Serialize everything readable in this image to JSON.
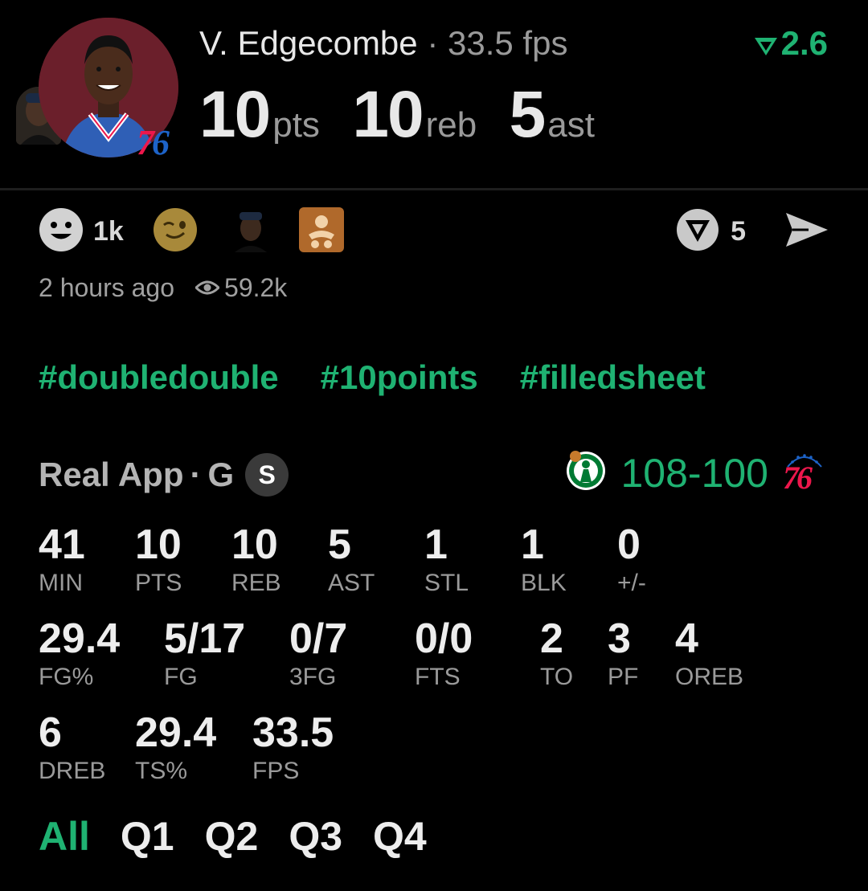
{
  "header": {
    "player_name": "V. Edgecombe",
    "separator": "·",
    "fps_text": "33.5 fps",
    "rating": "2.6",
    "team_logo": "76",
    "big_stats": [
      {
        "value": "10",
        "unit": "pts"
      },
      {
        "value": "10",
        "unit": "reb"
      },
      {
        "value": "5",
        "unit": "ast"
      }
    ]
  },
  "reactions": {
    "smiley_count": "1k",
    "share_count": "5"
  },
  "meta": {
    "time_ago": "2 hours ago",
    "views": "59.2k"
  },
  "hashtags": [
    "#doubledouble",
    "#10points",
    "#filledsheet"
  ],
  "game": {
    "source": "Real App",
    "separator": "·",
    "position": "G",
    "badge": "S",
    "score_winner": "108",
    "score_dash": "-",
    "score_loser": "100",
    "home_logo": "76"
  },
  "stats": [
    {
      "value": "41",
      "label": "MIN"
    },
    {
      "value": "10",
      "label": "PTS"
    },
    {
      "value": "10",
      "label": "REB"
    },
    {
      "value": "5",
      "label": "AST"
    },
    {
      "value": "1",
      "label": "STL"
    },
    {
      "value": "1",
      "label": "BLK"
    },
    {
      "value": "0",
      "label": "+/-"
    },
    {
      "value": "29.4",
      "label": "FG%"
    },
    {
      "value": "5/17",
      "label": "FG"
    },
    {
      "value": "0/7",
      "label": "3FG"
    },
    {
      "value": "0/0",
      "label": "FTS"
    },
    {
      "value": "2",
      "label": "TO"
    },
    {
      "value": "3",
      "label": "PF"
    },
    {
      "value": "4",
      "label": "OREB"
    },
    {
      "value": "6",
      "label": "DREB"
    },
    {
      "value": "29.4",
      "label": "TS%"
    },
    {
      "value": "33.5",
      "label": "FPS"
    }
  ],
  "tabs": [
    "All",
    "Q1",
    "Q2",
    "Q3",
    "Q4"
  ],
  "colors": {
    "accent": "#1fb272",
    "sixers_red": "#ed174c",
    "sixers_blue": "#1d63c8",
    "celtics_green": "#007a33"
  }
}
